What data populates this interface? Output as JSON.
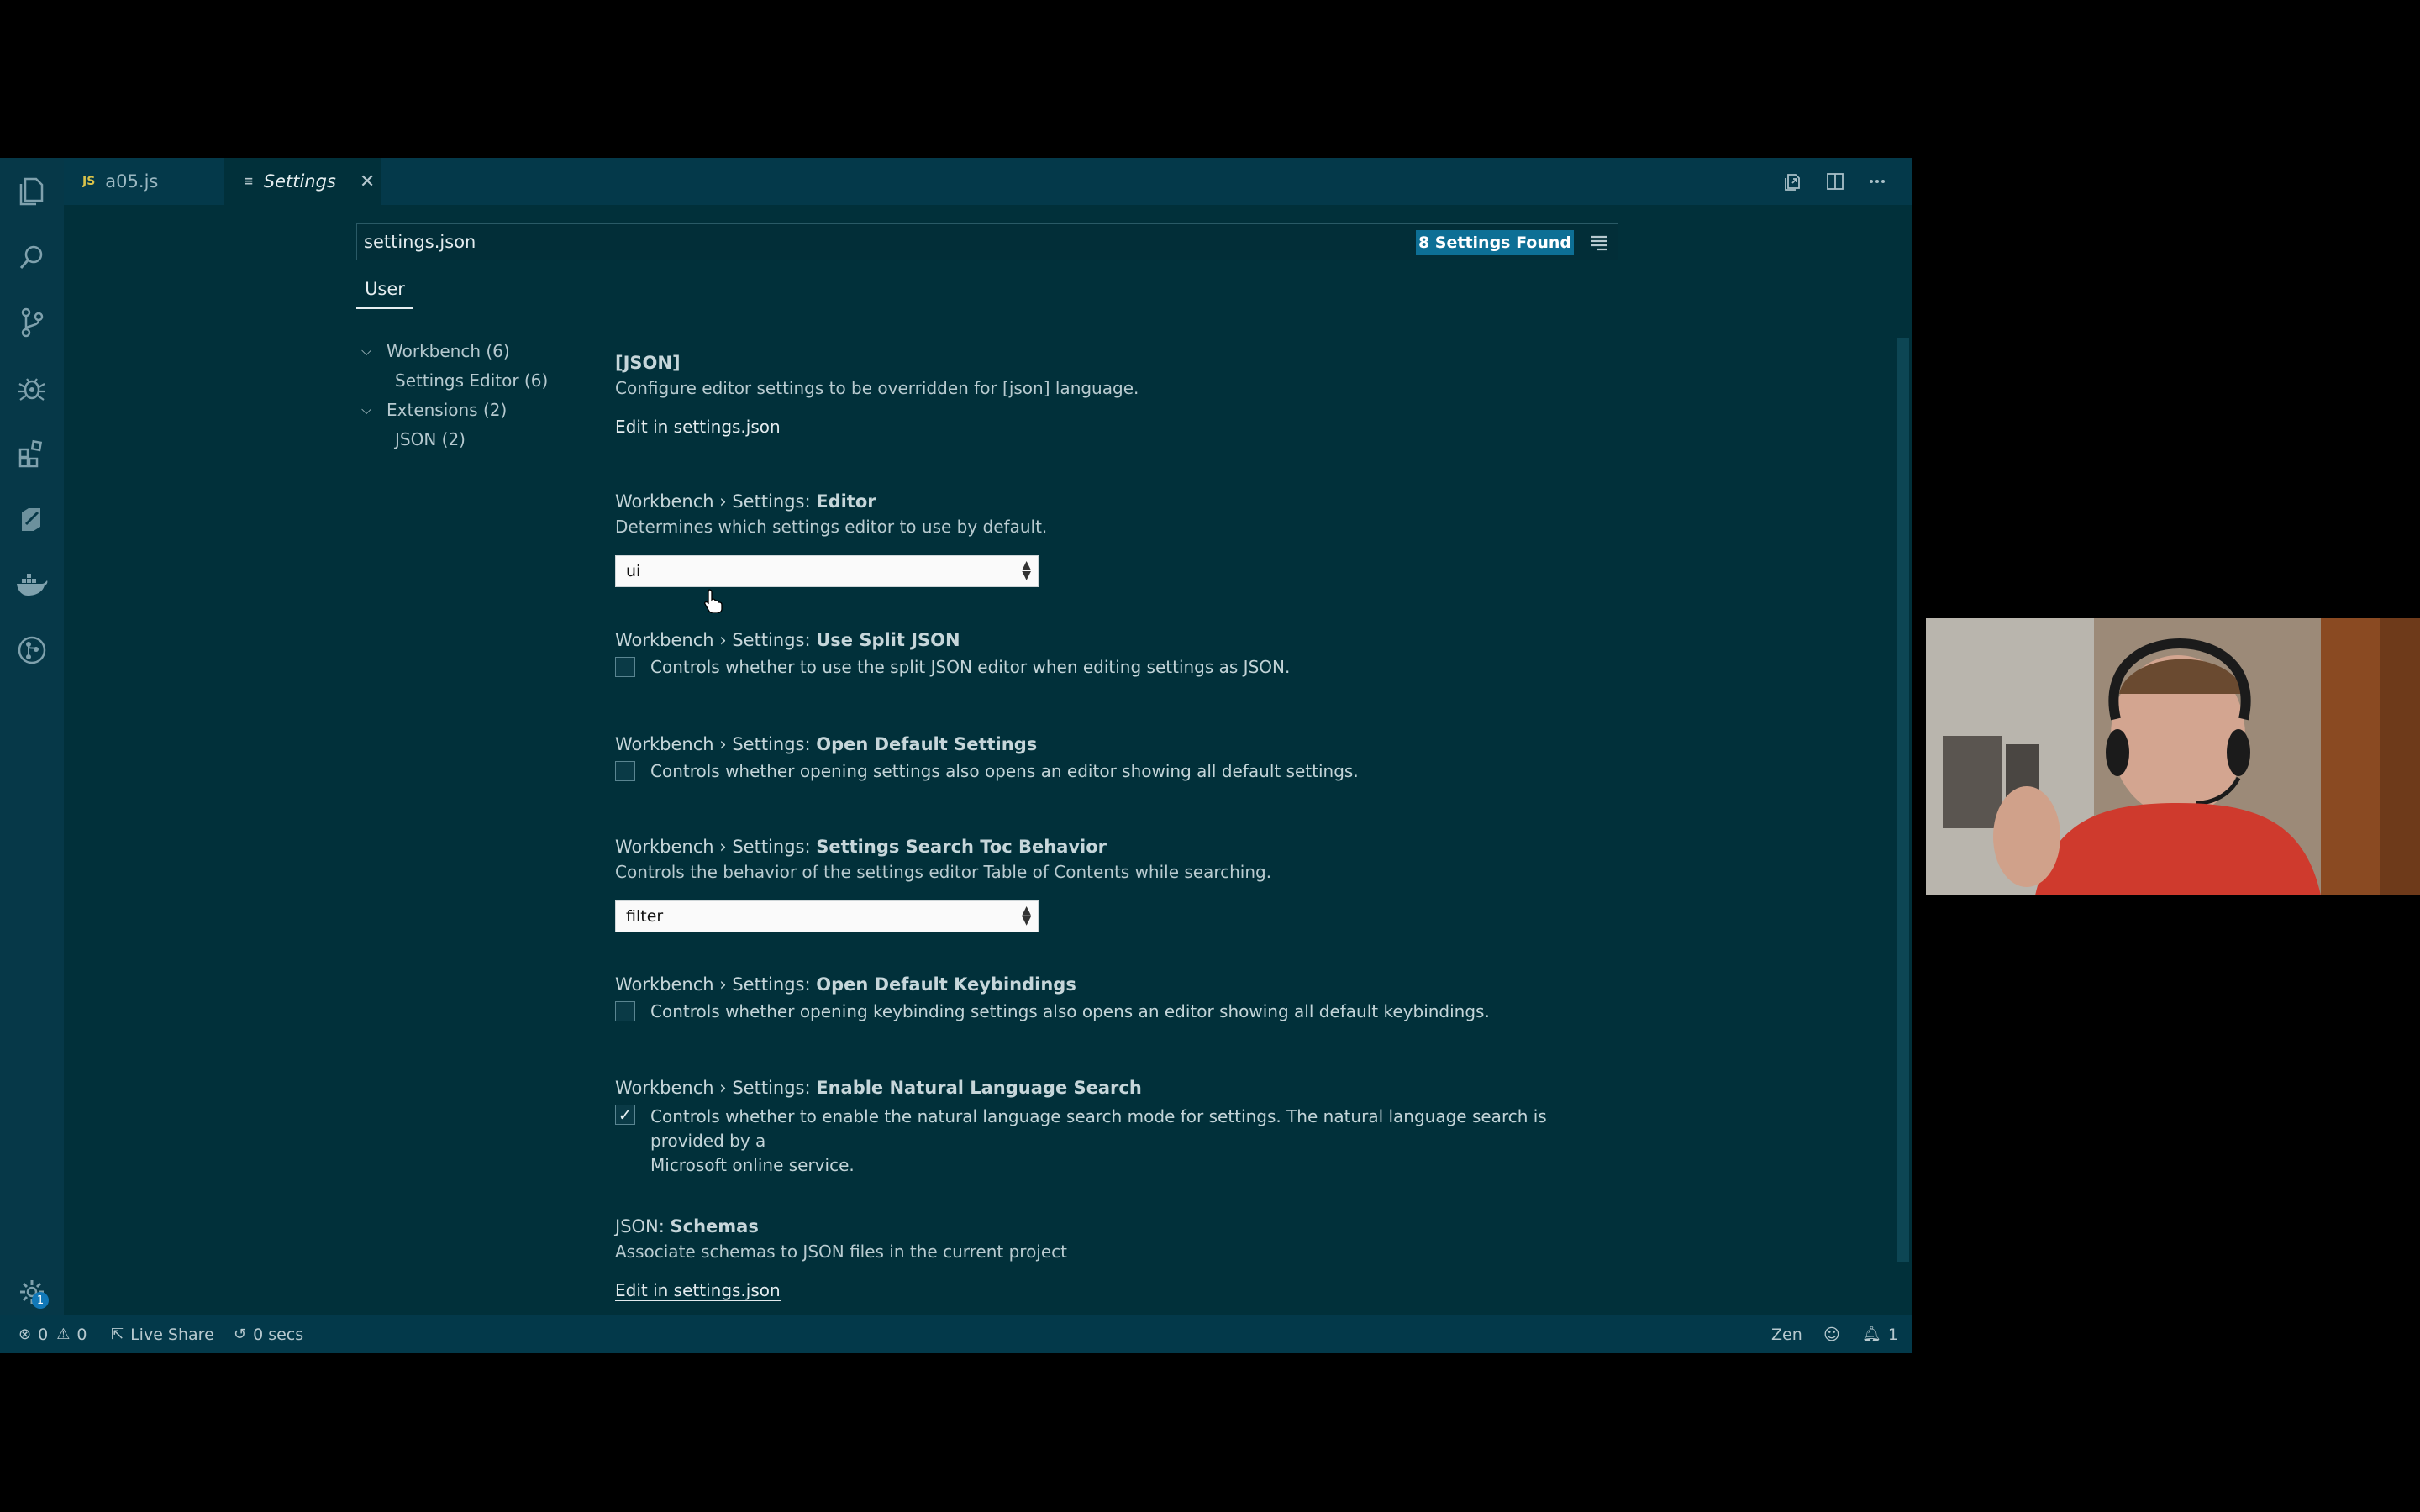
{
  "tabs": [
    {
      "label": "a05.js",
      "icon": "JS"
    },
    {
      "label": "Settings",
      "icon": "≡"
    }
  ],
  "search": {
    "value": "settings.json",
    "found_label": "8 Settings Found"
  },
  "scope_tab": "User",
  "toc": [
    {
      "label": "Workbench (6)",
      "expanded": true
    },
    {
      "label": "Settings Editor (6)"
    },
    {
      "label": "Extensions (2)",
      "expanded": true
    },
    {
      "label": "JSON (2)"
    }
  ],
  "settings": {
    "json": {
      "title": "[JSON]",
      "desc": "Configure editor settings to be overridden for [json] language.",
      "link": "Edit in settings.json"
    },
    "editor": {
      "cat": "Workbench › Settings: ",
      "name": "Editor",
      "desc": "Determines which settings editor to use by default.",
      "value": "ui"
    },
    "split": {
      "cat": "Workbench › Settings: ",
      "name": "Use Split JSON",
      "desc": "Controls whether to use the split JSON editor when editing settings as JSON.",
      "checked": false
    },
    "open_default": {
      "cat": "Workbench › Settings: ",
      "name": "Open Default Settings",
      "desc": "Controls whether opening settings also opens an editor showing all default settings.",
      "checked": false
    },
    "toc_behavior": {
      "cat": "Workbench › Settings: ",
      "name": "Settings Search Toc Behavior",
      "desc": "Controls the behavior of the settings editor Table of Contents while searching.",
      "value": "filter"
    },
    "keybindings": {
      "cat": "Workbench › Settings: ",
      "name": "Open Default Keybindings",
      "desc": "Controls whether opening keybinding settings also opens an editor showing all default keybindings.",
      "checked": false
    },
    "nls": {
      "cat": "Workbench › Settings: ",
      "name": "Enable Natural Language Search",
      "desc1": "Controls whether to enable the natural language search mode for settings. The natural language search is provided by a",
      "desc2": "Microsoft online service.",
      "checked": true
    },
    "schemas": {
      "cat": "JSON: ",
      "name": "Schemas",
      "desc": "Associate schemas to JSON files in the current project",
      "link": "Edit in settings.json"
    }
  },
  "status": {
    "errors": "0",
    "warnings": "0",
    "live_share": "Live Share",
    "timer": "0 secs",
    "zen": "Zen",
    "notifications": "1"
  },
  "activity_badge": "1",
  "colors": {
    "accent": "#0d6f95",
    "background": "#01303a",
    "sidebar": "#063848"
  }
}
